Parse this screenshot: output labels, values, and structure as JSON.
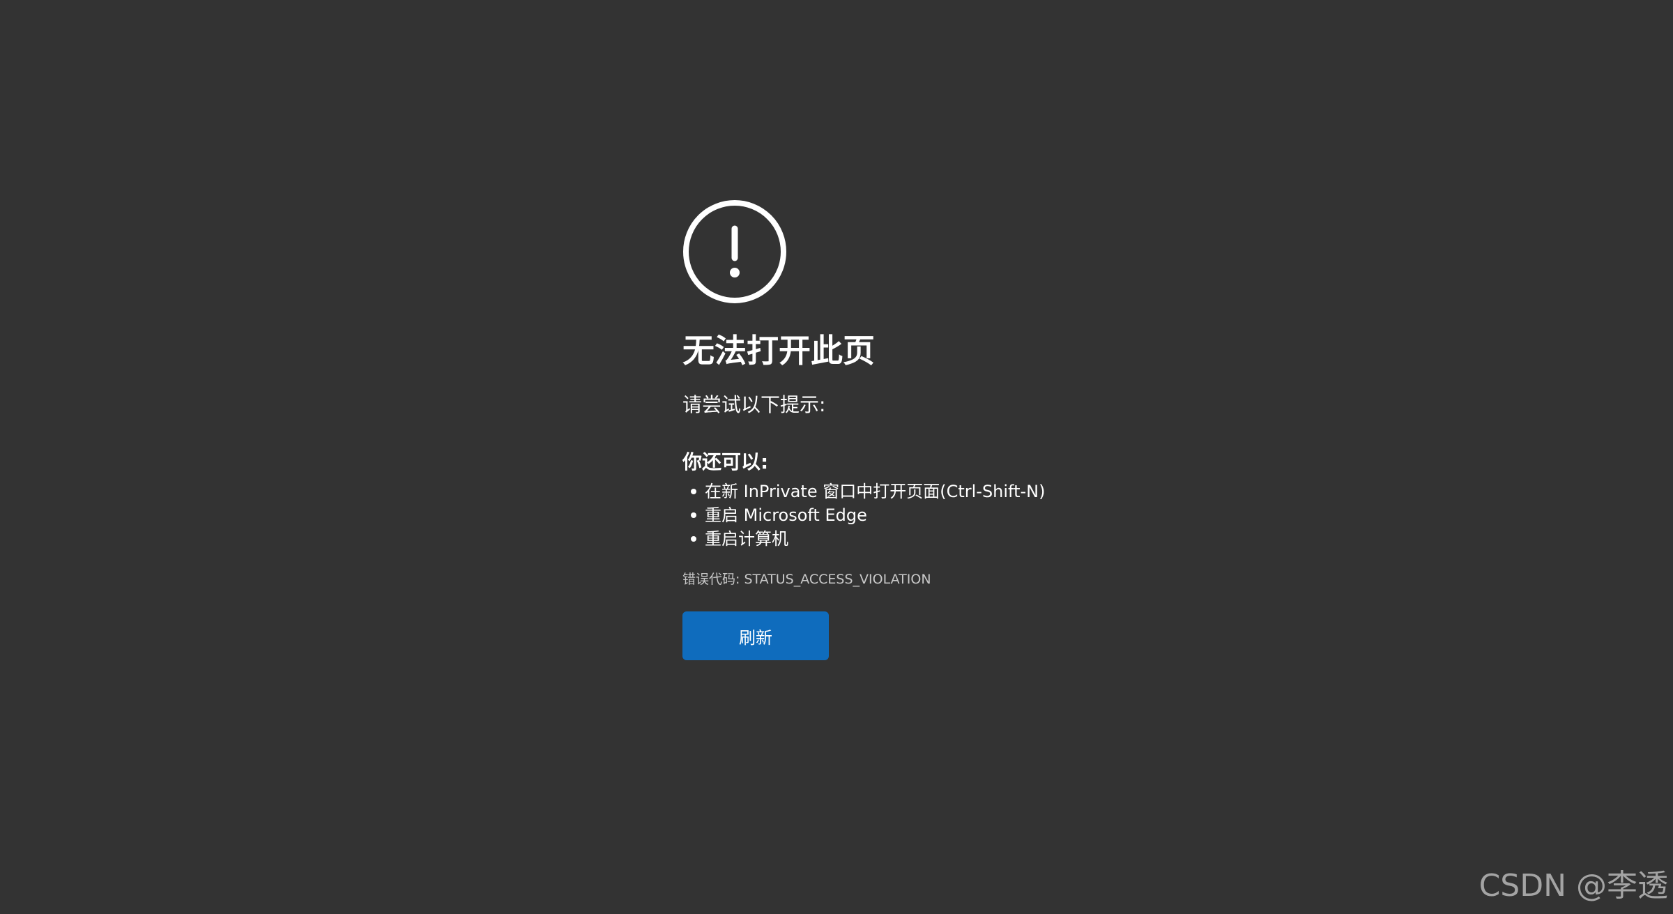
{
  "error": {
    "icon": "exclamation-circle-icon",
    "title": "无法打开此页",
    "subtitle": "请尝试以下提示:",
    "suggestions_heading": "你还可以:",
    "suggestions": [
      "在新 InPrivate 窗口中打开页面(Ctrl-Shift-N)",
      "重启 Microsoft Edge",
      "重启计算机"
    ],
    "error_code": "错误代码: STATUS_ACCESS_VIOLATION",
    "refresh_label": "刷新"
  },
  "watermark": {
    "text": "CSDN @李透"
  },
  "colors": {
    "background": "#333333",
    "text": "#ffffff",
    "muted_text": "#c8c8c8",
    "button": "#0f6cbd"
  }
}
